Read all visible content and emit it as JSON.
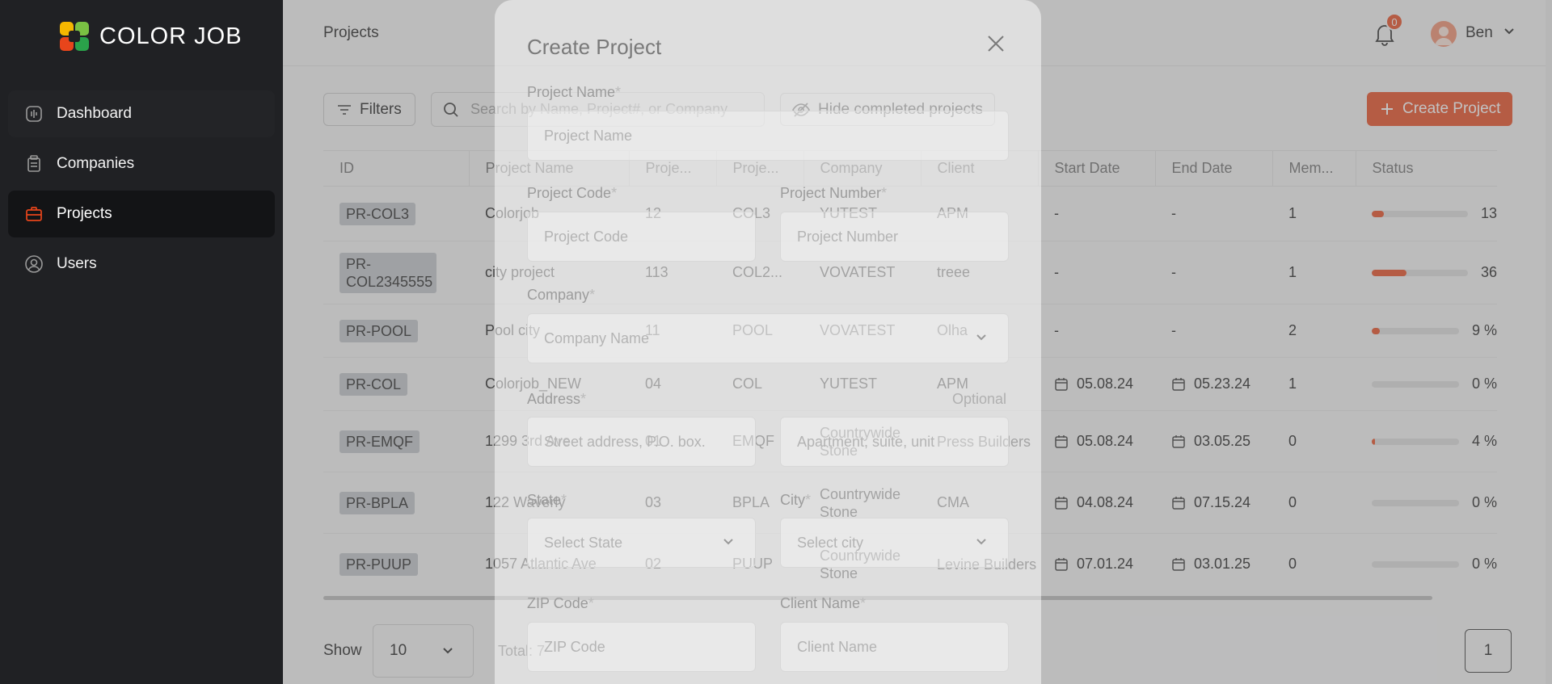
{
  "brand": {
    "name": "COLOR JOB"
  },
  "sidebar": {
    "items": [
      {
        "label": "Dashboard",
        "icon": "dashboard-icon"
      },
      {
        "label": "Companies",
        "icon": "companies-icon"
      },
      {
        "label": "Projects",
        "icon": "briefcase-icon",
        "active": true
      },
      {
        "label": "Users",
        "icon": "user-icon"
      }
    ]
  },
  "header": {
    "title": "Projects",
    "notification_count": "0",
    "user_name": "Ben"
  },
  "toolbar": {
    "filters_label": "Filters",
    "search_placeholder": "Search by Name, Project#, or Company",
    "hide_completed_label": "Hide completed projects",
    "create_label": "Create Project"
  },
  "table": {
    "columns": [
      "ID",
      "Project Name",
      "Proje...",
      "Proje...",
      "Company",
      "Client",
      "Start Date",
      "End Date",
      "Mem...",
      "Status"
    ],
    "rows": [
      {
        "id": "PR-COL3",
        "name": "Colorjob",
        "number": "12",
        "code": "COL3",
        "company": "YUTEST",
        "client": "APM",
        "start": "-",
        "end": "-",
        "members": "1",
        "progress": 13,
        "progress_label": "13"
      },
      {
        "id": "PR-COL2345555",
        "name": "city project",
        "number": "113",
        "code": "COL2...",
        "company": "VOVATEST",
        "client": "treee",
        "start": "-",
        "end": "-",
        "members": "1",
        "progress": 36,
        "progress_label": "36"
      },
      {
        "id": "PR-POOL",
        "name": "Pool city",
        "number": "11",
        "code": "POOL",
        "company": "VOVATEST",
        "client": "Olha",
        "start": "-",
        "end": "-",
        "members": "2",
        "progress": 9,
        "progress_label": "9 %"
      },
      {
        "id": "PR-COL",
        "name": "Colorjob_NEW",
        "number": "04",
        "code": "COL",
        "company": "YUTEST",
        "client": "APM",
        "start": "05.08.24",
        "end": "05.23.24",
        "members": "1",
        "progress": 0,
        "progress_label": "0 %"
      },
      {
        "id": "PR-EMQF",
        "name": "1299 3rd Ave",
        "number": "01",
        "code": "EMQF",
        "company": "Countrywide Stone",
        "client": "Press Builders",
        "start": "05.08.24",
        "end": "03.05.25",
        "members": "0",
        "progress": 4,
        "progress_label": "4 %"
      },
      {
        "id": "PR-BPLA",
        "name": "122 Waverly",
        "number": "03",
        "code": "BPLA",
        "company": "Countrywide Stone",
        "client": "CMA",
        "start": "04.08.24",
        "end": "07.15.24",
        "members": "0",
        "progress": 0,
        "progress_label": "0 %"
      },
      {
        "id": "PR-PUUP",
        "name": "1057 Atlantic Ave",
        "number": "02",
        "code": "PUUP",
        "company": "Countrywide Stone",
        "client": "Levine Builders",
        "start": "07.01.24",
        "end": "03.01.25",
        "members": "0",
        "progress": 0,
        "progress_label": "0 %"
      }
    ]
  },
  "footer": {
    "show_label": "Show",
    "page_size": "10",
    "total_label": "Total: 7",
    "current_page": "1"
  },
  "modal": {
    "title": "Create Project",
    "project_name_label": "Project Name",
    "project_name_placeholder": "Project Name",
    "project_code_label": "Project Code",
    "project_code_placeholder": "Project Code",
    "project_number_label": "Project Number",
    "project_number_placeholder": "Project Number",
    "company_label": "Company",
    "company_placeholder": "Company Name",
    "address_label": "Address",
    "address_optional": "Optional",
    "address_placeholder": "Street address, P.O. box.",
    "address2_placeholder": "Apartment, suite, unit",
    "state_label": "State",
    "state_placeholder": "Select State",
    "city_label": "City",
    "city_placeholder": "Select city",
    "zip_label": "ZIP Code",
    "zip_placeholder": "ZIP Code",
    "client_label": "Client Name",
    "client_placeholder": "Client Name",
    "required_mark": "*"
  },
  "colors": {
    "accent": "#e8451b",
    "sidebar_bg": "#202124",
    "active_nav": "#131416"
  }
}
